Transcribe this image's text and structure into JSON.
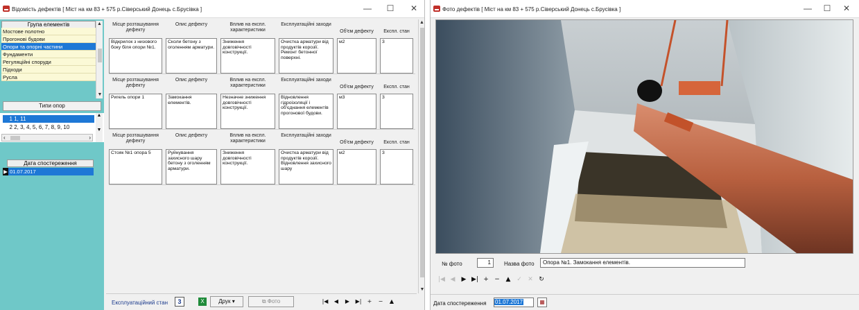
{
  "left_window": {
    "title": "Відомість дефектів [ Міст на км 83 + 575 р.Сіверський Донець с.Брусівка ]",
    "controls": [
      "—",
      "☐",
      "✕"
    ],
    "groups_header": "Група елементів",
    "groups": [
      "Мостове полотно",
      "Прогонові будови",
      "Опори та опорні частини",
      "Фундаменти",
      "Регуляційні споруди",
      "Підходи",
      "Русла"
    ],
    "selected_group_index": 2,
    "support_types_button": "Типи опор",
    "support_rows": [
      {
        "num": "1",
        "list": "1, 11"
      },
      {
        "num": "2",
        "list": "2, 3, 4, 5, 6, 7, 8, 9, 10"
      }
    ],
    "observation_header": "Дата спостереження",
    "observation_dates": [
      "01.07.2017"
    ],
    "columns": [
      "Місце розташування дефекту",
      "Опис дефекту",
      "Вплив на експл. характеристики",
      "Експлуатаційні заходи",
      "Об'єм дефекту",
      "Експл. стан"
    ],
    "defects": [
      {
        "location": "Відкрилок з низового боку біля опори №1.",
        "description": "Сколи бетону з оголенням арматури.",
        "impact": "Зниження довговічності конструкції.",
        "measures": "Очистка арматури від продуктів корозії. Ремонт бетонної поверхні.",
        "volume": "м2",
        "state": "3"
      },
      {
        "location": "Ригель опори 1",
        "description": "Замокання елементів.",
        "impact": "Незначне зниження довговічності конструкції.",
        "measures": "Відновлення гідроізоляції і об'єднання елементів прогонової будови.",
        "volume": "м3",
        "state": "3"
      },
      {
        "location": "Стояк №1 опора 5",
        "description": "Руйнування захисного шару бетону з оголенням арматури.",
        "impact": "Зниження довговічності конструкції.",
        "measures": "Очистка арматури від продуктів корозії. Відновлення захисного шару",
        "volume": "м2",
        "state": "3"
      }
    ],
    "status": {
      "label": "Експлуатаційний стан",
      "value": "3",
      "print_label": "Друк",
      "photo_label": "Фото"
    },
    "nav_buttons": [
      "|◀",
      "◀",
      "▶",
      "▶|",
      "+",
      "−",
      "▲"
    ]
  },
  "right_window": {
    "title": "Фото дефектів [ Міст на км 83 + 575 р.Сіверський Донець с.Брусівка ]",
    "controls": [
      "—",
      "☐",
      "✕"
    ],
    "photo_num_label": "№ фото",
    "photo_num": "1",
    "photo_name_label": "Назва фото",
    "photo_name": "Опора №1. Замокання елементів.",
    "nav_buttons": [
      "|◀",
      "◀",
      "▶",
      "▶|",
      "+",
      "−",
      "▲",
      "✓",
      "✕",
      "↻"
    ],
    "date_label": "Дата спостереження",
    "date_value": "01.07.2017"
  },
  "colors": {
    "accent": "#1e78d6",
    "panel": "#6fc8c8",
    "list_bg": "#fbf9d6",
    "status_value": "#1a3a8c"
  }
}
